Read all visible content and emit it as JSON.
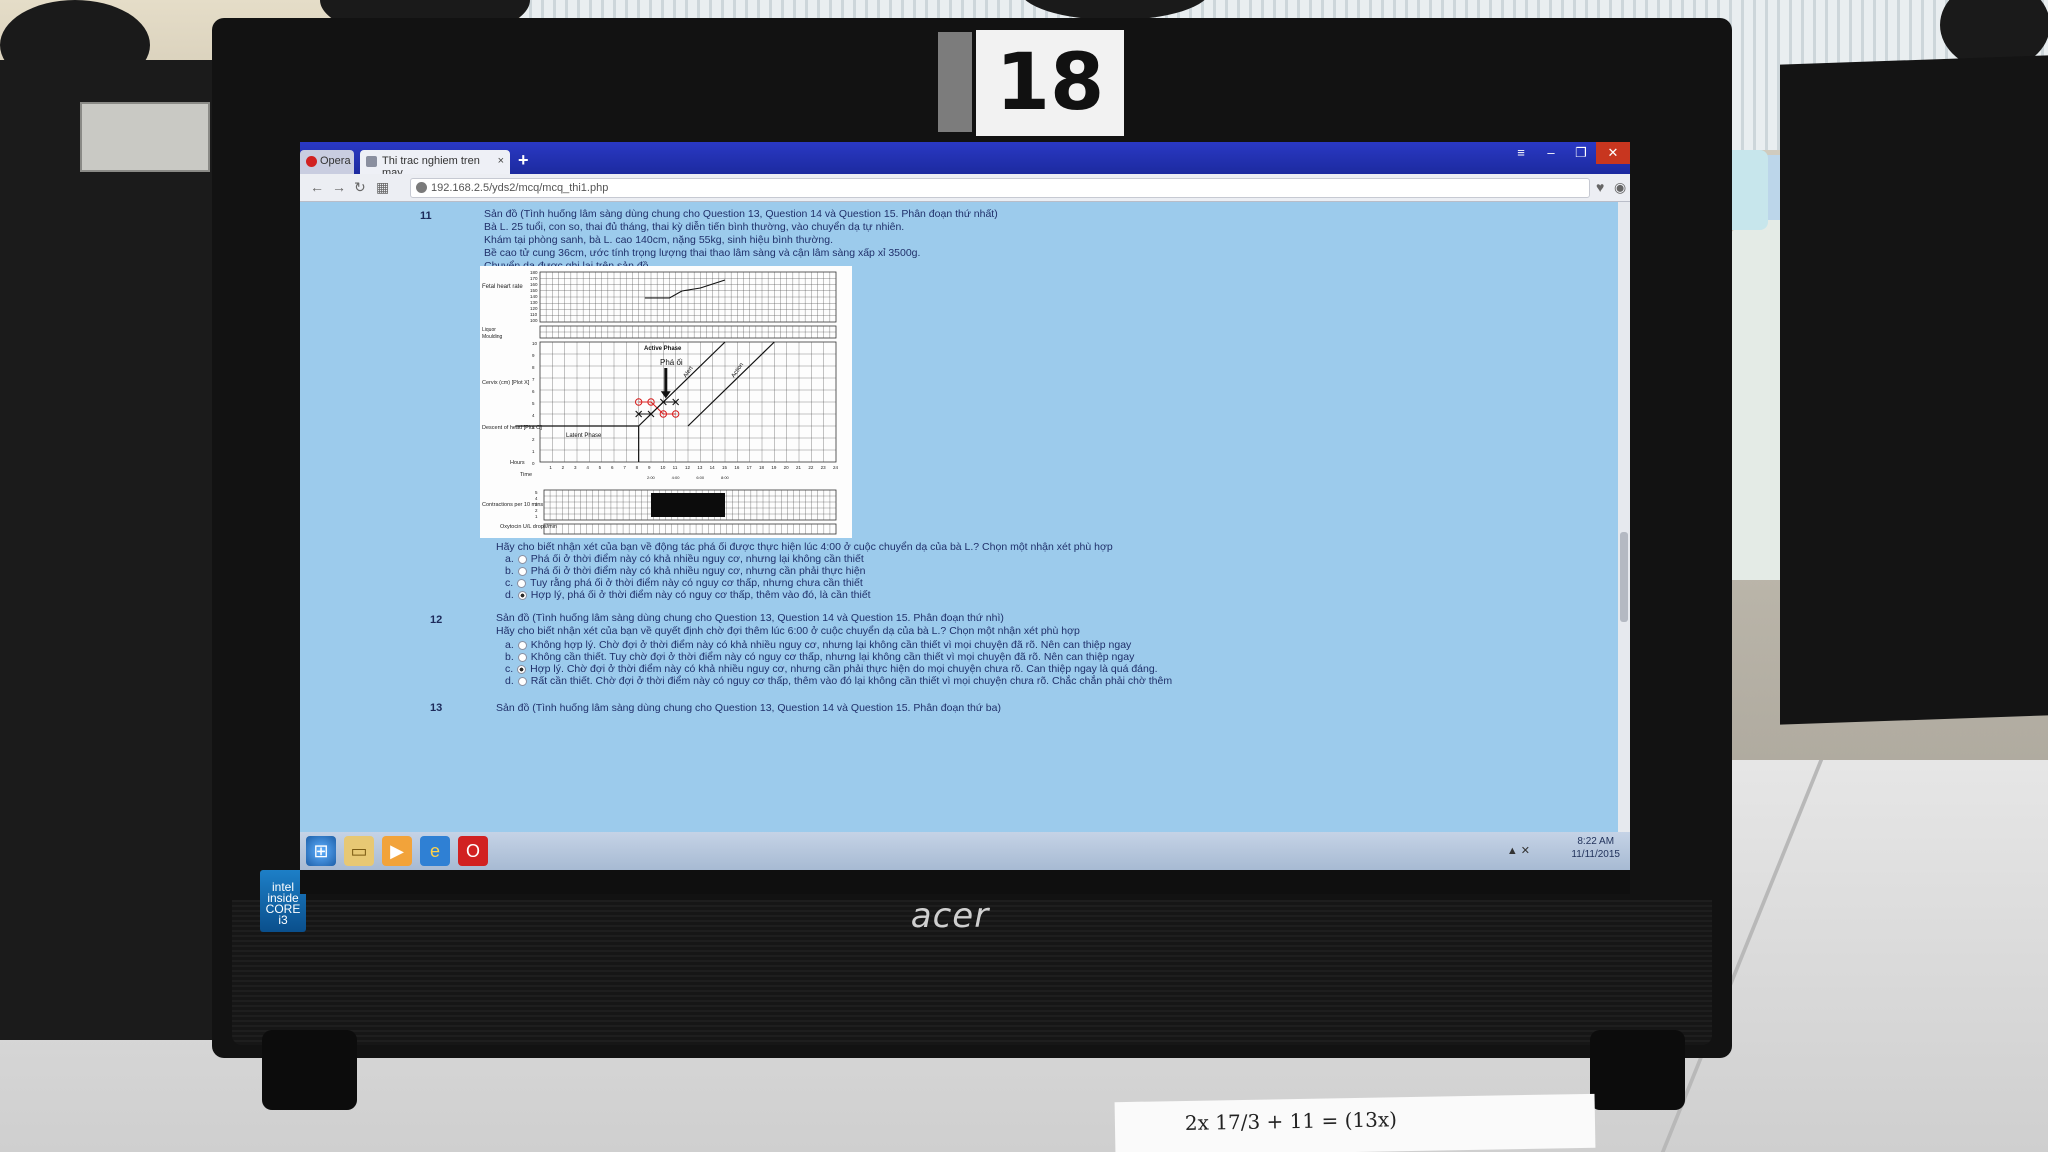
{
  "monitor": {
    "number": "18",
    "brand": "acer",
    "badge": "intel inside CORE i3"
  },
  "browser": {
    "opera_tab": "Opera",
    "active_tab": "Thi trac nghiem tren may",
    "tab_close": "×",
    "new_tab": "+",
    "url": "192.168.2.5/yds2/mcq/mcq_thi1.php",
    "window_buttons": {
      "menu": "≡",
      "minimize": "–",
      "maximize": "❐",
      "close": "✕"
    }
  },
  "questions": [
    {
      "number": "11",
      "text_lines": [
        "Sản đồ (Tình huống lâm sàng dùng chung cho Question 13, Question 14 và Question 15. Phân đoạn thứ nhất)",
        "Bà L. 25 tuổi, con so, thai đủ tháng, thai kỳ diễn tiến bình thường, vào chuyển dạ tự nhiên.",
        "Khám tại phòng sanh, bà L. cao 140cm, nặng 55kg, sinh hiệu bình thường.",
        "Bề cao tử cung 36cm, ước tính trọng lượng thai thao lâm sàng và cận lâm sàng xấp xỉ 3500g.",
        "Chuyển dạ được ghi lại trên sản đồ."
      ],
      "prompt": "Hãy cho biết nhận xét của bạn về động tác phá ối được thực hiện lúc 4:00 ở cuộc chuyển dạ của bà L.? Chọn một nhận xét phù hợp",
      "options": [
        {
          "letter": "a.",
          "text": "Phá ối ở thời điểm này có khả nhiều nguy cơ, nhưng lại không cần thiết",
          "selected": false
        },
        {
          "letter": "b.",
          "text": "Phá ối ở thời điểm này có khả nhiều nguy cơ, nhưng cần phải thực hiện",
          "selected": false
        },
        {
          "letter": "c.",
          "text": "Tuy rằng phá ối ở thời điểm này có nguy cơ thấp, nhưng chưa cần thiết",
          "selected": false
        },
        {
          "letter": "d.",
          "text": "Hợp lý, phá ối ở thời điểm này có nguy cơ thấp, thêm vào đó, là cần thiết",
          "selected": true
        }
      ]
    },
    {
      "number": "12",
      "text_lines": [
        "Sản đồ (Tình huống lâm sàng dùng chung cho Question 13, Question 14 và Question 15. Phân đoạn thứ nhì)",
        "Hãy cho biết nhận xét của bạn về quyết định chờ đợi thêm lúc 6:00 ở cuộc chuyển dạ của bà L.? Chọn một nhận xét phù hợp"
      ],
      "options": [
        {
          "letter": "a.",
          "text": "Không hợp lý. Chờ đợi ở thời điểm này có khả nhiều nguy cơ, nhưng lại không cần thiết vì mọi chuyện đã rõ. Nên can thiệp ngay",
          "selected": false
        },
        {
          "letter": "b.",
          "text": "Không cần thiết. Tuy chờ đợi ở thời điểm này có nguy cơ thấp, nhưng lại không cần thiết vì mọi chuyện đã rõ. Nên can thiệp ngay",
          "selected": false
        },
        {
          "letter": "c.",
          "text": "Hợp lý. Chờ đợi ở thời điểm này có khả nhiều nguy cơ, nhưng cần phải thực hiện do mọi chuyện chưa rõ. Can thiệp ngay là quá đáng.",
          "selected": true
        },
        {
          "letter": "d.",
          "text": "Rất cần thiết. Chờ đợi ở thời điểm này có nguy cơ thấp, thêm vào đó lại không cần thiết vì mọi chuyện chưa rõ. Chắc chắn phải chờ thêm",
          "selected": false
        }
      ]
    },
    {
      "number": "13",
      "text_lines": [
        "Sản đồ (Tình huống lâm sàng dùng chung cho Question 13, Question 14 và Question 15. Phân đoạn thứ ba)"
      ],
      "options": []
    }
  ],
  "partograph": {
    "labels": {
      "fhr": "Fetal heart rate",
      "liquor": "Liquor",
      "moulding": "Moulding",
      "cervix": "Cervix (cm) [Plot X]",
      "descent": "Descent of head [Plot O]",
      "hours": "Hours",
      "time": "Time",
      "contractions": "Contractions per 10 mins",
      "oxytocin": "Oxytocin U/L drops/min",
      "active_phase": "Active Phase",
      "latent_phase": "Latent Phase",
      "alert": "Alert",
      "action": "Action",
      "rupture": "Phá ối"
    },
    "fhr_ticks": [
      "180",
      "170",
      "160",
      "150",
      "140",
      "130",
      "120",
      "110",
      "100"
    ],
    "cervix_ticks": [
      "10",
      "9",
      "8",
      "7",
      "6",
      "5",
      "4",
      "3",
      "2",
      "1",
      "0"
    ],
    "hour_ticks": [
      "1",
      "2",
      "3",
      "4",
      "5",
      "6",
      "7",
      "8",
      "9",
      "10",
      "11",
      "12",
      "13",
      "14",
      "15",
      "16",
      "17",
      "18",
      "19",
      "20",
      "21",
      "22",
      "23",
      "24"
    ],
    "time_marks": [
      "2:00",
      "4:00",
      "6:00",
      "8:00"
    ],
    "contraction_ticks": [
      "5",
      "4",
      "3",
      "2",
      "1"
    ],
    "cervix_points": [
      [
        8,
        4
      ],
      [
        9,
        4
      ],
      [
        10,
        5
      ],
      [
        11,
        5
      ]
    ],
    "descent_points": [
      [
        8,
        5
      ],
      [
        9,
        5
      ],
      [
        10,
        4
      ],
      [
        11,
        4
      ]
    ],
    "colors": {
      "descent": "#d81e1e",
      "grid": "#444444",
      "lines": "#111111"
    }
  },
  "taskbar": {
    "icons": [
      "windows-start",
      "file-explorer",
      "media-player",
      "internet-explorer",
      "opera"
    ],
    "time": "8:22 AM",
    "date": "11/11/2015"
  },
  "desk_note": "2x 17/3 + 11 = (13x)"
}
